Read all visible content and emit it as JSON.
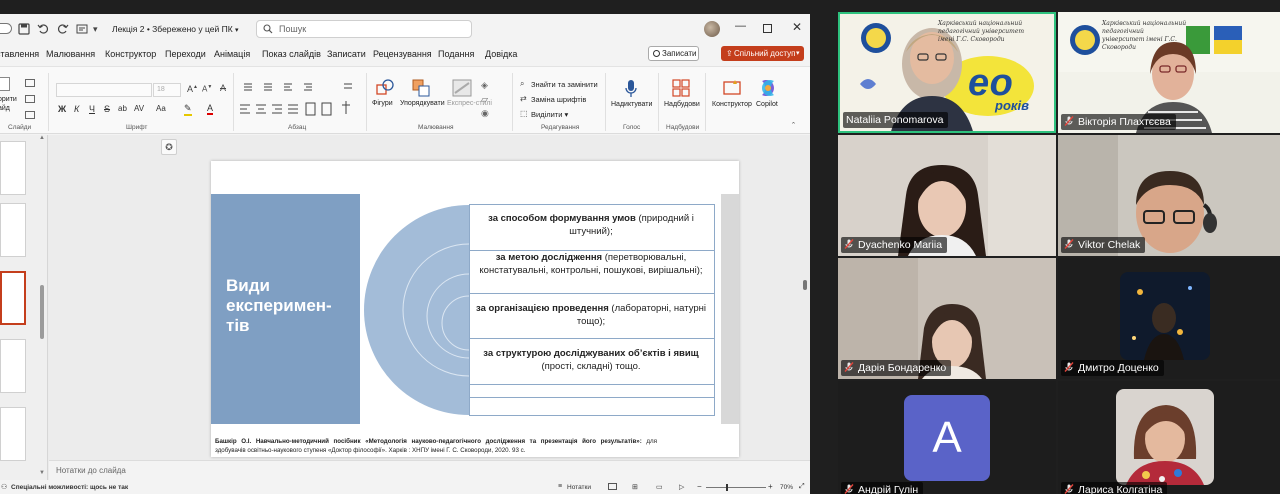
{
  "ppt": {
    "title": "Лекція 2 • Збережено у цей ПК",
    "search_placeholder": "Пошук",
    "tabs": [
      "ставлення",
      "Малювання",
      "Конструктор",
      "Переходи",
      "Анімація",
      "Показ слайдів",
      "Записати",
      "Рецензування",
      "Подання",
      "Довідка"
    ],
    "record_label": "Записати",
    "share_label": "Спільний доступ",
    "ribbon": {
      "clipboard_partial": "орити\nайд",
      "group_slides": "Слайди",
      "group_font": "Шрифт",
      "font_size": "18",
      "group_paragraph": "Абзац",
      "shapes": "Фігури",
      "arrange": "Упорядкувати",
      "quick_styles": "Експрес-стилі",
      "group_drawing": "Малювання",
      "find_replace": "Знайти та замінити",
      "replace_fonts": "Заміна шрифтів",
      "select": "Виділити",
      "group_editing": "Редагування",
      "dictate": "Надиктувати",
      "group_voice": "Голос",
      "addins": "Надбудови",
      "group_addins": "Надбудови",
      "designer": "Конструктор",
      "copilot": "Copilot"
    },
    "notes_placeholder": "Нотатки до слайда",
    "status": {
      "accessibility": "Спеціальні можливості: щось не так",
      "notes": "Нотатки",
      "zoom": "70%"
    },
    "slide": {
      "title": "Види експеримен-тів",
      "rows": [
        {
          "bold": "за способом формування умов",
          "normal": " (природний і штучний);"
        },
        {
          "bold": "за метою дослідження",
          "normal": " (перетворювальні, констатувальні, контрольні, пошукові, вирішальні);"
        },
        {
          "bold": "за організацією проведення",
          "normal": " (лабораторні, натурні тощо);"
        },
        {
          "bold": "за структурою досліджуваних об’єктів і явищ",
          "normal": " (прості, складні) тощо."
        }
      ],
      "citation_bold": "Башкір О.І. Навчально-методичний посібник «Методологія науково-педагогічного дослідження та презентація його результатів»:",
      "citation_normal": " для здобувачів освітньо-наукового ступеня «Доктор філософії». Харків : ХНПУ імені Г. С. Сковороди, 2020. 93 с."
    }
  },
  "participants": [
    {
      "name": "Nataliia Ponomarova",
      "muted": false,
      "active": true
    },
    {
      "name": "Вікторія Плахтєєва",
      "muted": true
    },
    {
      "name": "Dyachenko Mariia",
      "muted": true
    },
    {
      "name": "Viktor Chelak",
      "muted": true
    },
    {
      "name": "Дарія Бондаренко",
      "muted": true
    },
    {
      "name": "Дмитро Доценко",
      "muted": true
    },
    {
      "name": "Андрій Гулін",
      "muted": true,
      "avatar_letter": "A"
    },
    {
      "name": "Лариса Колгатіна",
      "muted": true
    }
  ],
  "logo_text": {
    "banner_small": "Харківський національний педагогічний університет імені Г.С. Сковороди",
    "banner_big": "ео",
    "banner_years": "років"
  },
  "colors": {
    "ppt_accent": "#c43e1c",
    "slide_blue": "#7f9fc3",
    "arc_blue": "#a3bcd8",
    "active_border": "#2ec27e",
    "avatar_bg": "#5a63c8"
  }
}
